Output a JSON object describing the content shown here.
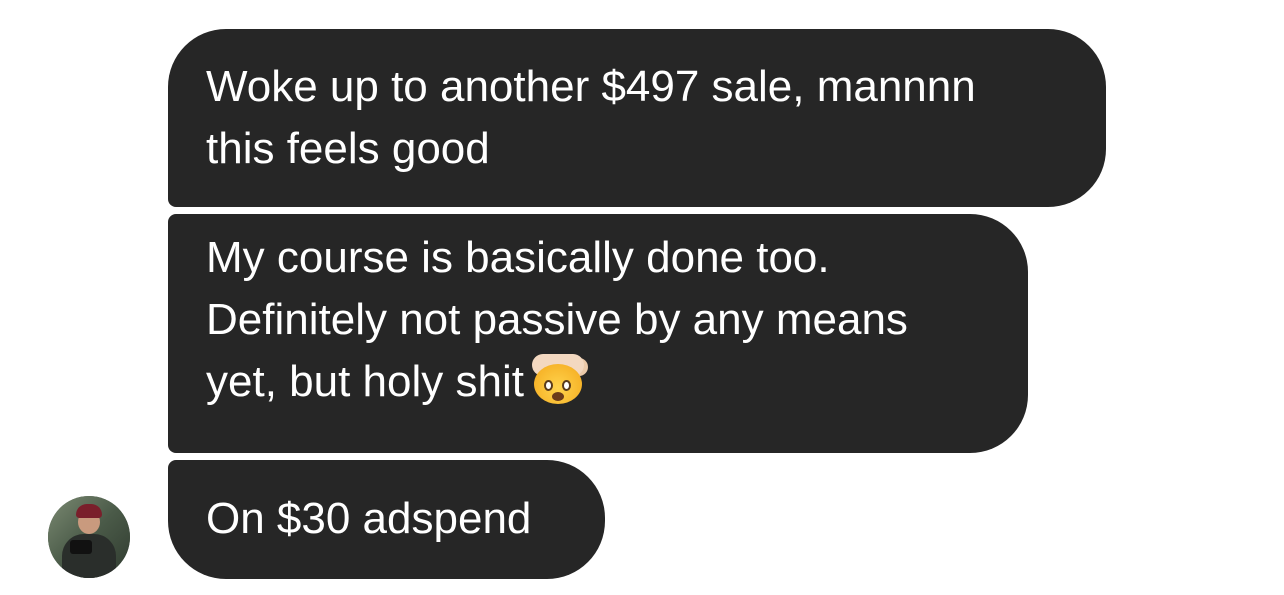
{
  "messages": [
    {
      "lines": [
        "Woke up to another $497 sale, mannnn",
        "this feels good"
      ]
    },
    {
      "lines": [
        "My course is basically done too.",
        "Definitely not passive by any means",
        "yet, but holy shit"
      ],
      "emoji": "exploding-head-icon"
    },
    {
      "lines": [
        "On $30 adspend"
      ]
    }
  ],
  "sender": {
    "avatar": "profile-photo"
  },
  "colors": {
    "bubble": "#262626",
    "text": "#ffffff",
    "background": "#ffffff"
  }
}
